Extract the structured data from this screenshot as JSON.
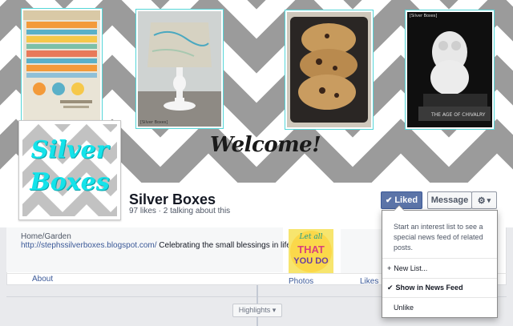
{
  "cover": {
    "welcome_text": "Welcome!",
    "photo_captions": [
      "[Silver Boxes]",
      "[Silver Boxes]"
    ],
    "book_spine_text": "THE AGE OF CHIVALRY"
  },
  "profile": {
    "logo_line1": "Silver",
    "logo_line2": "Boxes"
  },
  "page": {
    "name": "Silver Boxes",
    "stats": "97 likes · 2 talking about this"
  },
  "actions": {
    "liked_label": "Liked",
    "message_label": "Message",
    "gear_label": "▾"
  },
  "info": {
    "category": "Home/Garden",
    "url": "http://stephssilverboxes.blogspot.com/",
    "description": " Celebrating the small blessings in life"
  },
  "tabs": {
    "about": "About",
    "photos": "Photos",
    "likes": "Likes"
  },
  "photos_thumb": {
    "line1": "Let all",
    "line2": "THAT",
    "line3": "YOU DO"
  },
  "timeline": {
    "highlights_label": "Highlights ▾"
  },
  "dropdown": {
    "description": "Start an interest list to see a special news feed of related posts.",
    "new_list": "New List...",
    "show_in_news_feed": "Show in News Feed",
    "unlike": "Unlike"
  },
  "colors": {
    "facebook_blue": "#3b5998",
    "liked_button": "#5b74a8",
    "logo_cyan": "#14e3ea",
    "frame_cyan": "#55d6d8"
  }
}
